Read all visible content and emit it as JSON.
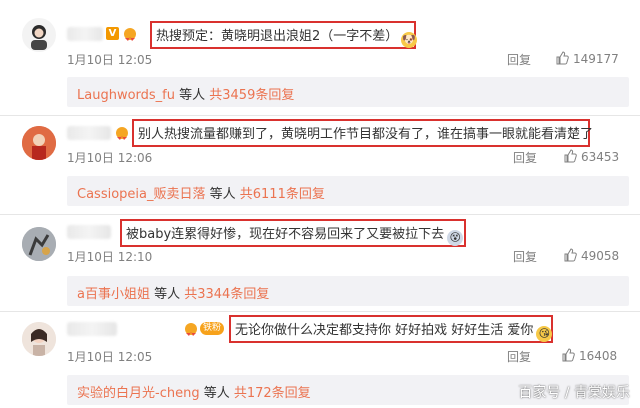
{
  "comments": [
    {
      "text": "热搜预定：黄晓明退出浪姐2（一字不差）",
      "time": "1月10日 12:05",
      "reply_label": "回复",
      "likes": "149177",
      "sub": {
        "user": "Laughwords_fu",
        "etc": " 等人 ",
        "total": "共3459条回复"
      },
      "badge": "V"
    },
    {
      "text": "别人热搜流量都赚到了，黄晓明工作节目都没有了，谁在搞事一眼就能看清楚了",
      "time": "1月10日 12:06",
      "reply_label": "回复",
      "likes": "63453",
      "sub": {
        "user": "Cassiopeia_贩卖日落",
        "etc": " 等人 ",
        "total": "共6111条回复"
      }
    },
    {
      "text": "被baby连累得好惨，现在好不容易回来了又要被拉下去",
      "time": "1月10日 12:10",
      "reply_label": "回复",
      "likes": "49058",
      "sub": {
        "user": "a百事小姐姐",
        "etc": " 等人 ",
        "total": "共3344条回复"
      }
    },
    {
      "text": "无论你做什么决定都支持你 好好拍戏 好好生活 爱你",
      "time": "1月10日 12:05",
      "reply_label": "回复",
      "likes": "16408",
      "sub": {
        "user": "实验的白月光-cheng",
        "etc": " 等人 ",
        "total": "共172条回复"
      },
      "badge": "铁粉"
    }
  ],
  "watermark": "百家号 / 青棠娱乐",
  "colors": {
    "highlight_border": "#d9312e",
    "link": "#eb7350",
    "meta": "#808080",
    "subbar_bg": "#f2f2f5"
  }
}
